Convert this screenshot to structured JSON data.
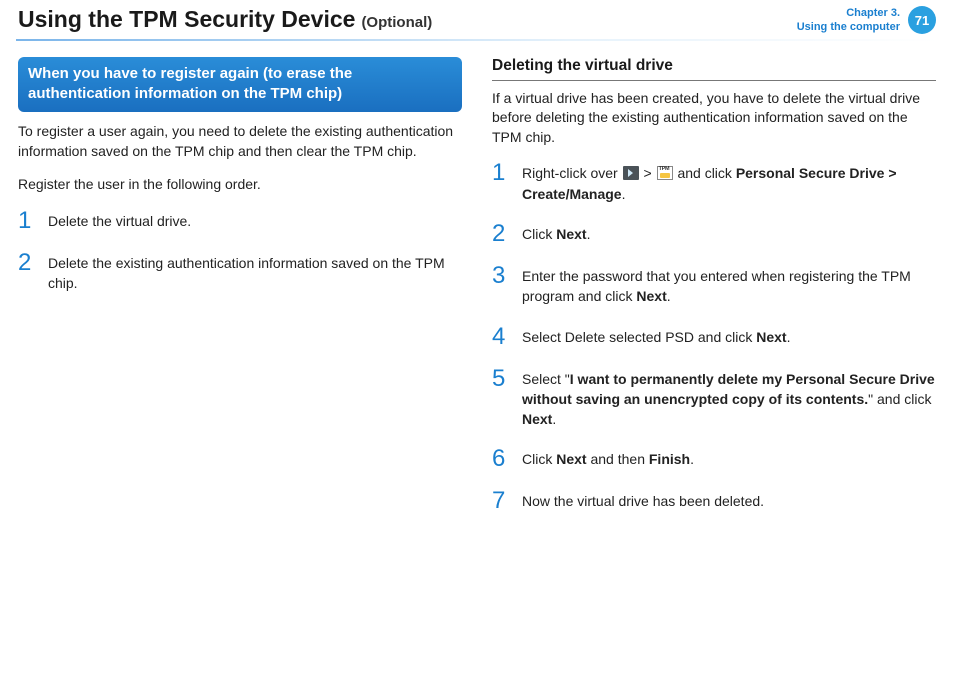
{
  "header": {
    "title": "Using the TPM Security Device",
    "optional": "(Optional)",
    "chapter_line1": "Chapter 3.",
    "chapter_line2": "Using the computer",
    "page_number": "71"
  },
  "left": {
    "callout": "When you have to register again (to erase the authentication information on the TPM chip)",
    "intro1": "To register a user again, you need to delete the existing authentication information saved on the TPM chip and then clear the TPM chip.",
    "intro2": "Register the user in the following order.",
    "steps": [
      {
        "n": "1",
        "text": "Delete the virtual drive."
      },
      {
        "n": "2",
        "text": "Delete the existing authentication information saved on the TPM chip."
      }
    ]
  },
  "right": {
    "heading": "Deleting the virtual drive",
    "intro": "If a virtual drive has been created, you have to delete the virtual drive before deleting the existing authentication information saved on the TPM chip.",
    "steps": {
      "s1_pre": "Right-click over ",
      "s1_gt": " > ",
      "s1_mid": " and click ",
      "s1_bold": "Personal Secure Drive > Create/Manage",
      "s1_end": ".",
      "s2_pre": "Click ",
      "s2_bold": "Next",
      "s2_end": ".",
      "s3_pre": "Enter the password that you entered when registering the TPM program and click ",
      "s3_bold": "Next",
      "s3_end": ".",
      "s4_pre": "Select Delete selected PSD and click ",
      "s4_bold": "Next",
      "s4_end": ".",
      "s5_pre": "Select \"",
      "s5_bold": "I want to permanently delete my Personal Secure Drive without saving an unencrypted copy of its contents.",
      "s5_mid": "\" and click ",
      "s5_bold2": "Next",
      "s5_end": ".",
      "s6_pre": "Click ",
      "s6_bold1": "Next",
      "s6_mid": " and then ",
      "s6_bold2": "Finish",
      "s6_end": ".",
      "s7": "Now the virtual drive has been deleted."
    },
    "nums": {
      "n1": "1",
      "n2": "2",
      "n3": "3",
      "n4": "4",
      "n5": "5",
      "n6": "6",
      "n7": "7"
    }
  }
}
